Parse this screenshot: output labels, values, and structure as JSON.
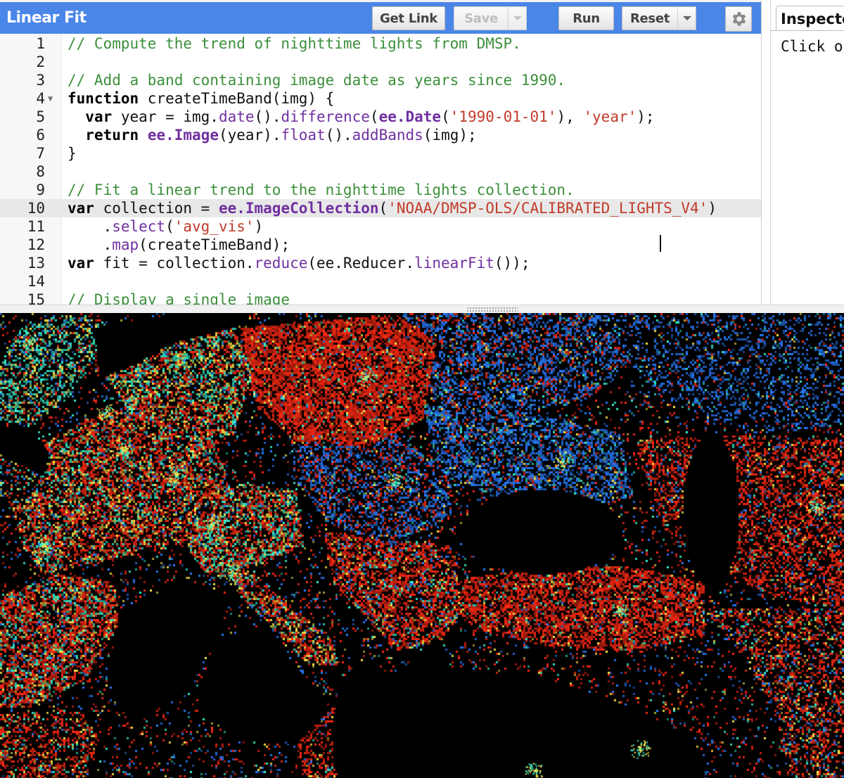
{
  "toolbar": {
    "title": "Linear Fit",
    "get_link_label": "Get Link",
    "save_label": "Save",
    "run_label": "Run",
    "reset_label": "Reset"
  },
  "editor": {
    "active_line": 10,
    "lines": [
      {
        "n": "1",
        "segs": [
          [
            "c",
            "// Compute the trend of nighttime lights from DMSP."
          ]
        ]
      },
      {
        "n": "2",
        "segs": []
      },
      {
        "n": "3",
        "segs": [
          [
            "c",
            "// Add a band containing image date as years since 1990."
          ]
        ]
      },
      {
        "n": "4",
        "fold": true,
        "segs": [
          [
            "k",
            "function"
          ],
          [
            "p",
            " createTimeBand(img) {"
          ]
        ]
      },
      {
        "n": "5",
        "segs": [
          [
            "p",
            "  "
          ],
          [
            "k",
            "var"
          ],
          [
            "p",
            " year = img."
          ],
          [
            "f",
            "date"
          ],
          [
            "p",
            "()."
          ],
          [
            "f",
            "difference"
          ],
          [
            "p",
            "("
          ],
          [
            "e",
            "ee.Date"
          ],
          [
            "p",
            "("
          ],
          [
            "s",
            "'1990-01-01'"
          ],
          [
            "p",
            "), "
          ],
          [
            "s",
            "'year'"
          ],
          [
            "p",
            ");"
          ]
        ]
      },
      {
        "n": "6",
        "segs": [
          [
            "p",
            "  "
          ],
          [
            "k",
            "return"
          ],
          [
            "p",
            " "
          ],
          [
            "e",
            "ee.Image"
          ],
          [
            "p",
            "(year)."
          ],
          [
            "f",
            "float"
          ],
          [
            "p",
            "()."
          ],
          [
            "f",
            "addBands"
          ],
          [
            "p",
            "(img);"
          ]
        ]
      },
      {
        "n": "7",
        "segs": [
          [
            "p",
            "}"
          ]
        ]
      },
      {
        "n": "8",
        "segs": []
      },
      {
        "n": "9",
        "segs": [
          [
            "c",
            "// Fit a linear trend to the nighttime lights collection."
          ]
        ]
      },
      {
        "n": "10",
        "segs": [
          [
            "k",
            "var"
          ],
          [
            "p",
            " collection = "
          ],
          [
            "e",
            "ee.ImageCollection"
          ],
          [
            "p",
            "("
          ],
          [
            "s",
            "'NOAA/DMSP-OLS/CALIBRATED_LIGHTS_V4'"
          ],
          [
            "p",
            ")"
          ]
        ]
      },
      {
        "n": "11",
        "segs": [
          [
            "p",
            "    ."
          ],
          [
            "f",
            "select"
          ],
          [
            "p",
            "("
          ],
          [
            "s",
            "'avg_vis'"
          ],
          [
            "p",
            ")"
          ]
        ]
      },
      {
        "n": "12",
        "segs": [
          [
            "p",
            "    ."
          ],
          [
            "f",
            "map"
          ],
          [
            "p",
            "(createTimeBand);"
          ]
        ]
      },
      {
        "n": "13",
        "segs": [
          [
            "k",
            "var"
          ],
          [
            "p",
            " fit = collection."
          ],
          [
            "f",
            "reduce"
          ],
          [
            "p",
            "(ee.Reducer."
          ],
          [
            "f",
            "linearFit"
          ],
          [
            "p",
            "());"
          ]
        ]
      },
      {
        "n": "14",
        "segs": []
      },
      {
        "n": "15",
        "segs": [
          [
            "c",
            "// Display a single image"
          ]
        ]
      }
    ]
  },
  "inspector": {
    "tab_label": "Inspector",
    "hint": "Click on the map to inspect the layers."
  },
  "colors": {
    "toolbar_bg": "#4a86e8",
    "comment": "#3c8f3c",
    "keyword": "#000000",
    "ee_class": "#7030a0",
    "method": "#7030a0",
    "string": "#c13b2b",
    "map_bg": "#000000",
    "light_red": "#ff2a14",
    "light_cyan": "#38f0d0",
    "light_yellow": "#ffe94a",
    "light_blue": "#2a7dff"
  },
  "icons": {
    "settings": "gear-icon",
    "dropdown": "chevron-down-icon",
    "fold": "fold-arrow-icon"
  }
}
